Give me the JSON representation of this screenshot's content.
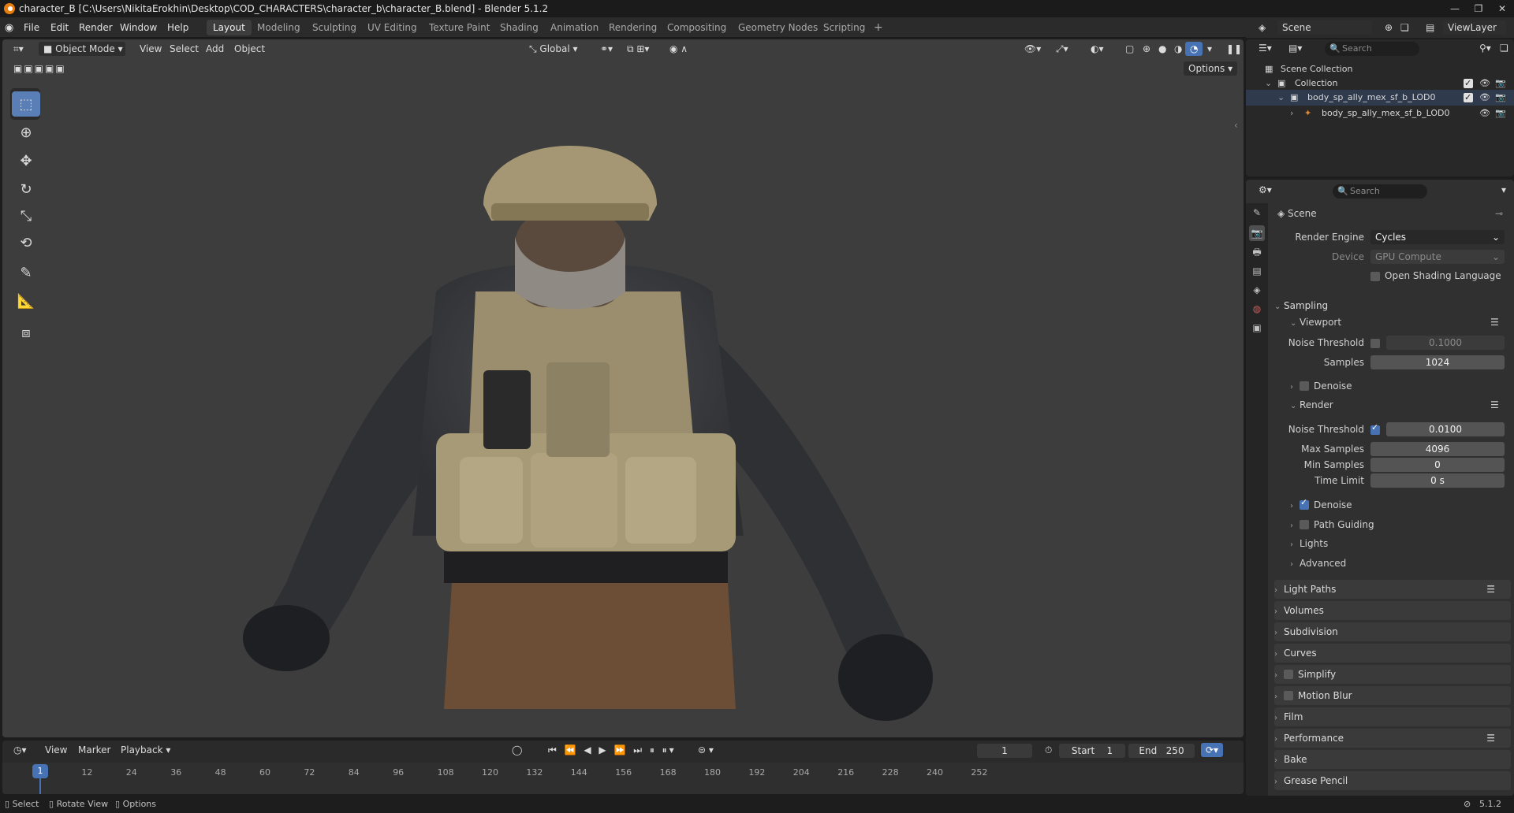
{
  "window": {
    "title": "character_B [C:\\Users\\NikitaErokhin\\Desktop\\COD_CHARACTERS\\character_b\\character_B.blend] - Blender 5.1.2"
  },
  "menu": [
    "File",
    "Edit",
    "Render",
    "Window",
    "Help"
  ],
  "workspaces": [
    "Layout",
    "Modeling",
    "Sculpting",
    "UV Editing",
    "Texture Paint",
    "Shading",
    "Animation",
    "Rendering",
    "Compositing",
    "Geometry Nodes",
    "Scripting"
  ],
  "active_workspace": "Layout",
  "scene_selector": {
    "scene": "Scene",
    "view_layer": "ViewLayer"
  },
  "viewport_header": {
    "mode": "Object Mode",
    "menus": [
      "View",
      "Select",
      "Add",
      "Object"
    ],
    "orientation": "Global",
    "options": "Options"
  },
  "outliner": {
    "search_placeholder": "Search",
    "root": "Scene Collection",
    "collection": "Collection",
    "items": [
      "body_sp_ally_mex_sf_b_LOD0",
      "body_sp_ally_mex_sf_b_LOD0"
    ]
  },
  "properties": {
    "search_placeholder": "Search",
    "context": "Scene",
    "render_engine_label": "Render Engine",
    "render_engine": "Cycles",
    "device_label": "Device",
    "device": "GPU Compute",
    "osl_label": "Open Shading Language",
    "sampling": "Sampling",
    "viewport": "Viewport",
    "vp_noise_threshold_label": "Noise Threshold",
    "vp_noise_threshold": "0.1000",
    "vp_samples_label": "Samples",
    "vp_samples": "1024",
    "vp_denoise": "Denoise",
    "render": "Render",
    "r_noise_threshold_label": "Noise Threshold",
    "r_noise_threshold": "0.0100",
    "max_samples_label": "Max Samples",
    "max_samples": "4096",
    "min_samples_label": "Min Samples",
    "min_samples": "0",
    "time_limit_label": "Time Limit",
    "time_limit": "0 s",
    "r_denoise": "Denoise",
    "path_guiding": "Path Guiding",
    "lights": "Lights",
    "advanced": "Advanced",
    "sections": [
      "Light Paths",
      "Volumes",
      "Subdivision",
      "Curves",
      "Simplify",
      "Motion Blur",
      "Film",
      "Performance",
      "Bake",
      "Grease Pencil"
    ]
  },
  "timeline": {
    "menus": [
      "View",
      "Marker",
      "Playback"
    ],
    "current_frame": "1",
    "start_label": "Start",
    "start": "1",
    "end_label": "End",
    "end": "250",
    "ticks": [
      "1",
      "12",
      "24",
      "36",
      "48",
      "60",
      "72",
      "84",
      "96",
      "108",
      "120",
      "132",
      "144",
      "156",
      "168",
      "180",
      "192",
      "204",
      "216",
      "228",
      "240",
      "252"
    ]
  },
  "status": {
    "select": "Select",
    "rotate": "Rotate View",
    "options": "Options",
    "version": "5.1.2"
  }
}
